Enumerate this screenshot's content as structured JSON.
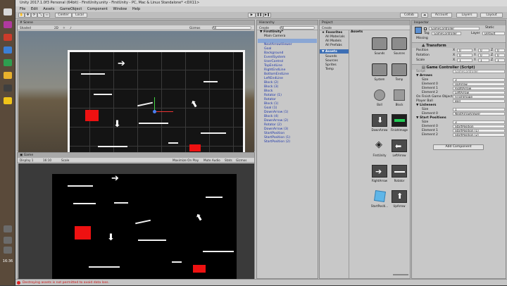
{
  "window": {
    "title": "Unity 2017.1.0f3 Personal (64bit) - FirstUnity.unity - FirstUnity - PC, Mac & Linux Standalone* <DX11>"
  },
  "menu": [
    "File",
    "Edit",
    "Assets",
    "GameObject",
    "Component",
    "Window",
    "Help"
  ],
  "toolbar": {
    "center": "Center",
    "local": "Local",
    "collab": "Collab",
    "account": "Account",
    "layers": "Layers",
    "layout": "Layout"
  },
  "scene": {
    "tab": "Scene",
    "shading": "Shaded",
    "mode2d": "2D",
    "gizmos": "Gizmos",
    "search": "All"
  },
  "game": {
    "tab": "Game",
    "display": "Display 1",
    "aspect": "16:10",
    "scale": "Scale",
    "maximize": "Maximize On Play",
    "mute": "Mute Audio",
    "stats": "Stats",
    "gizmos": "Gizmos"
  },
  "hierarchy": {
    "tab": "Hierarchy",
    "create": "Create",
    "search": "All",
    "scene": "FirstUnity*",
    "items": [
      "Main Camera",
      "NextArrowViewer",
      "Goal",
      "Background",
      "EventSystem",
      "UserControl",
      "TopEndLine",
      "RightEndLine",
      "BottomEndLine",
      "LeftEndLine",
      "Block (2)",
      "Block (3)",
      "Block",
      "Rotator (1)",
      "Rotator",
      "Block (1)",
      "Goal (1)",
      "DownArrow (1)",
      "Block (4)",
      "DownArrow (2)",
      "Rotator (2)",
      "DownArrow (3)",
      "StartPosition",
      "StartPosition (1)",
      "StartPosition (2)"
    ]
  },
  "project": {
    "tab": "Project",
    "create": "Create",
    "favorites": "Favorites",
    "fav_items": [
      "All Materials",
      "All Models",
      "All Prefabs"
    ],
    "assets": "Assets",
    "folders": [
      "Sounds",
      "Sources",
      "Sprites",
      "Temp"
    ],
    "header": "Assets",
    "grid": [
      "Sounds",
      "Sources",
      "System",
      "Temp",
      "Ball",
      "Block",
      "DownArrow",
      "FinishImage",
      "FirstUnity",
      "LeftArrow",
      "RightArrow",
      "Rotator",
      "StartPositi...",
      "UpArrow"
    ]
  },
  "inspector": {
    "tab": "Inspector",
    "object": "GameController",
    "static": "Static",
    "tag_label": "Tag",
    "tag": "GameController",
    "layer_label": "Layer",
    "layer": "Default",
    "missing": "Missing",
    "transform": "Transform",
    "position": {
      "label": "Position",
      "x": "0",
      "y": "0",
      "z": "0"
    },
    "rotation": {
      "label": "Rotation",
      "x": "0",
      "y": "0",
      "z": "0"
    },
    "scale": {
      "label": "Scale",
      "x": "1",
      "y": "1",
      "z": "1"
    },
    "component": "Game Controller (Script)",
    "script_label": "Script",
    "script": "GameController",
    "arrows_label": "Arrows",
    "size_label": "Size",
    "arrows_size": "3",
    "arrows": [
      {
        "label": "Element 0",
        "value": "UpArrow"
      },
      {
        "label": "Element 1",
        "value": "RightArrow"
      },
      {
        "label": "Element 2",
        "value": "LeftArrow"
      }
    ],
    "finish_label": "On Finish Game Object",
    "finish": "FinishImage",
    "player_label": "Player Ball",
    "player": "Ball",
    "listeners_label": "Listeners",
    "listeners_size": "1",
    "listeners": [
      {
        "label": "Element 0",
        "value": "NextArrowViewer"
      }
    ],
    "start_label": "Start Positions",
    "start_size": "3",
    "starts": [
      {
        "label": "Element 0",
        "value": "StartPosition"
      },
      {
        "label": "Element 1",
        "value": "StartPosition (1)"
      },
      {
        "label": "Element 2",
        "value": "StartPosition (2)"
      }
    ],
    "add_component": "Add Component"
  },
  "status": "Destroying assets is not permitted to avoid data loss.",
  "clock": "16:36",
  "colors": {
    "accent_red": "#ee1111",
    "link_blue": "#1a33aa",
    "selection": "#3d6fb5"
  }
}
